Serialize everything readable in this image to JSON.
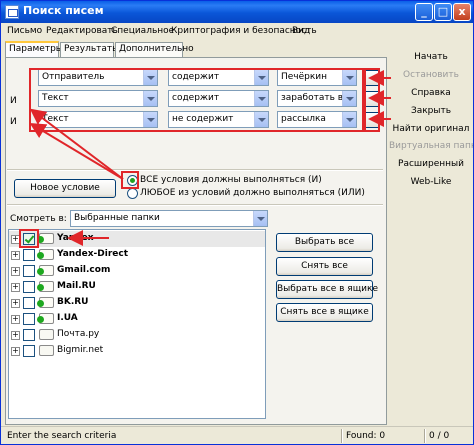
{
  "window": {
    "title": "Поиск писем"
  },
  "titlebar_buttons": {
    "minimize": "_",
    "maximize": "□",
    "close": "x"
  },
  "menu": [
    "Письмо",
    "Редактировать",
    "Специальное",
    "Криптография и безопасность",
    "Вид"
  ],
  "tabs": [
    "Параметры",
    "Результаты",
    "Дополнительно"
  ],
  "conditions": [
    {
      "prefix": "",
      "field": "Отправитель",
      "operator": "содержит",
      "value": "Печёркин",
      "remove": "-"
    },
    {
      "prefix": "И",
      "field": "Текст",
      "operator": "содержит",
      "value": "заработать в пар",
      "remove": "-"
    },
    {
      "prefix": "И",
      "field": "Текст",
      "operator": "не содержит",
      "value": "рассылка",
      "remove": "-"
    }
  ],
  "new_condition_button": "Новое условие",
  "match_mode": {
    "options": [
      {
        "label": "ВСЕ условия должны выполняться (И)",
        "selected": true
      },
      {
        "label": "ЛЮБОЕ из условий должно выполняться (ИЛИ)",
        "selected": false
      }
    ]
  },
  "look_in": {
    "label": "Смотреть в:",
    "value": "Выбранные папки"
  },
  "folders": [
    {
      "name": "Yandex",
      "checked": true,
      "expand": "+",
      "icon": "mail-account-icon",
      "bold": true
    },
    {
      "name": "Yandex-Direct",
      "checked": false,
      "expand": "+",
      "icon": "mail-account-icon",
      "bold": true
    },
    {
      "name": "Gmail.com",
      "checked": false,
      "expand": "+",
      "icon": "mail-account-icon",
      "bold": true
    },
    {
      "name": "Mail.RU",
      "checked": false,
      "expand": "+",
      "icon": "mail-account-icon",
      "bold": true
    },
    {
      "name": "BK.RU",
      "checked": false,
      "expand": "+",
      "icon": "mail-account-icon",
      "bold": true
    },
    {
      "name": "I.UA",
      "checked": false,
      "expand": "+",
      "icon": "mail-account-icon",
      "bold": true
    },
    {
      "name": "Почта.ру",
      "checked": false,
      "expand": "+",
      "icon": "folder-icon",
      "bold": false
    },
    {
      "name": "Bigmir.net",
      "checked": false,
      "expand": "+",
      "icon": "folder-icon",
      "bold": false
    }
  ],
  "folder_buttons": [
    "Выбрать все",
    "Снять все",
    "Выбрать все в ящике",
    "Снять все в ящике"
  ],
  "sidebar": [
    {
      "label": "Начать",
      "enabled": true
    },
    {
      "label": "Остановить",
      "enabled": false
    },
    {
      "label": "Справка",
      "enabled": true
    },
    {
      "label": "Закрыть",
      "enabled": true
    },
    {
      "label": "Найти оригинал",
      "enabled": true
    },
    {
      "label": "Виртуальная папка",
      "enabled": false
    },
    {
      "label": "Расширенный",
      "enabled": true
    },
    {
      "label": "Web-Like",
      "enabled": true
    }
  ],
  "status": {
    "text": "Enter the search criteria",
    "found": "Found: 0",
    "count": "0 / 0"
  },
  "colors": {
    "annotation": "#e0262a",
    "title_bar": "#0a56d8",
    "check": "#21a121"
  }
}
